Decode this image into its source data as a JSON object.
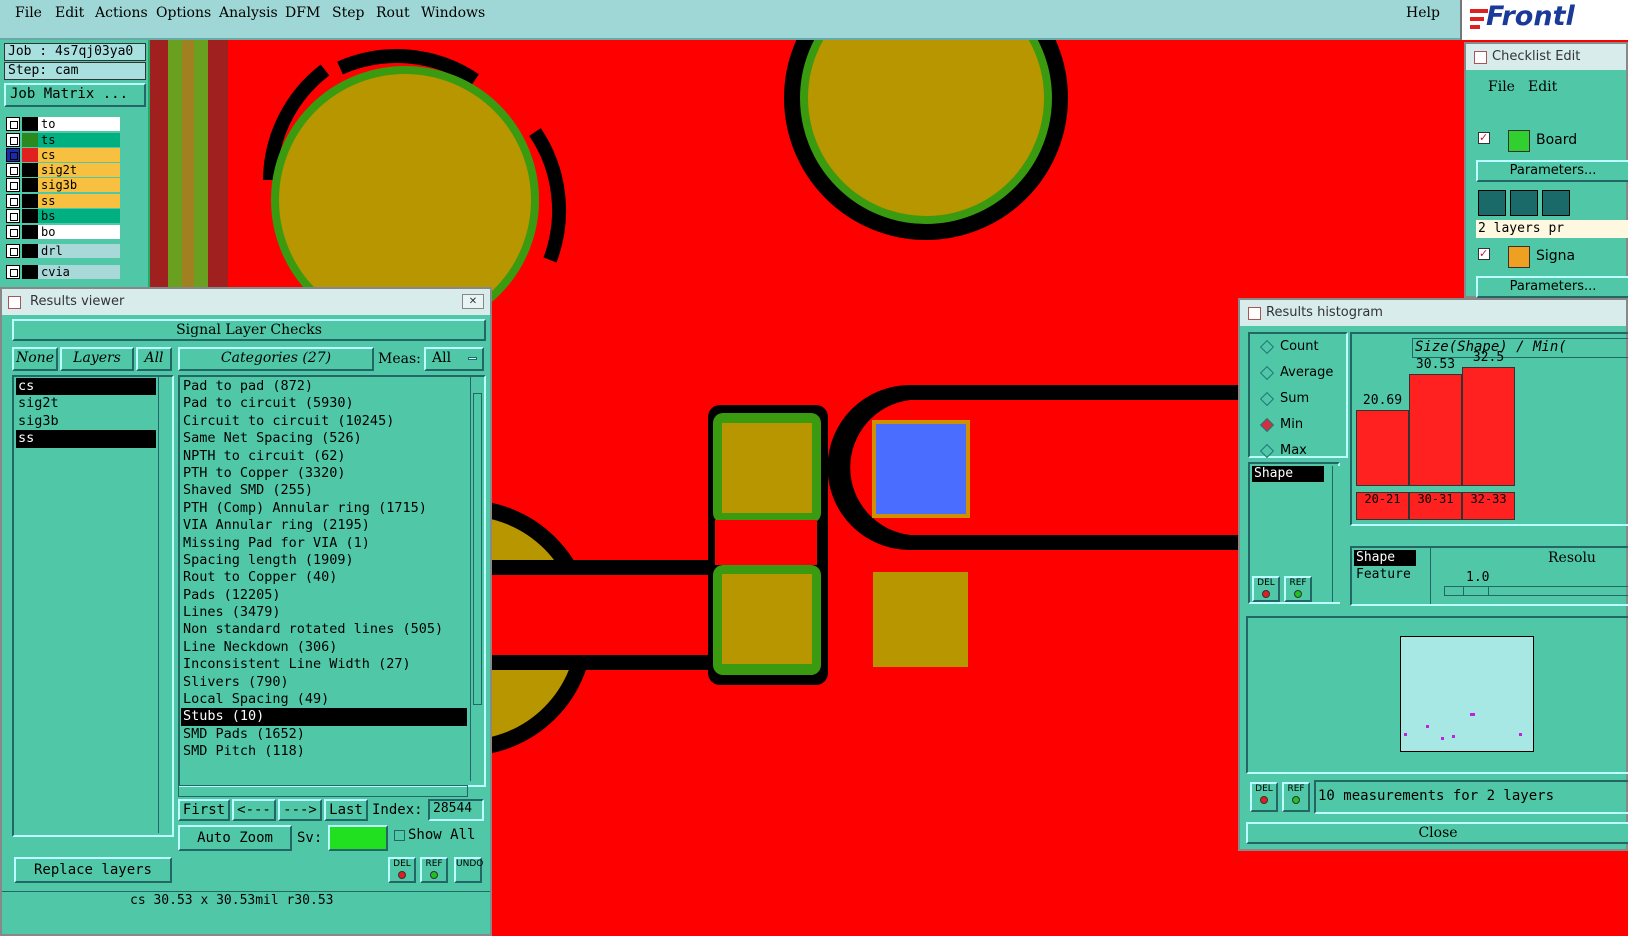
{
  "menubar": {
    "items": [
      "File",
      "Edit",
      "Actions",
      "Options",
      "Analysis",
      "DFM",
      "Step",
      "Rout",
      "Windows"
    ],
    "help": "Help",
    "brand": "Frontl"
  },
  "job": {
    "job_label": "Job : 4s7qj03ya0",
    "step_label": "Step: cam",
    "matrix_button": "Job Matrix ..."
  },
  "layers": [
    {
      "name": "to",
      "color": "#ffffff"
    },
    {
      "name": "ts",
      "color": "#00b080"
    },
    {
      "name": "cs",
      "color": "#f8c040"
    },
    {
      "name": "sig2t",
      "color": "#f8c040"
    },
    {
      "name": "sig3b",
      "color": "#f8c040"
    },
    {
      "name": "ss",
      "color": "#f8c040"
    },
    {
      "name": "bs",
      "color": "#00b080"
    },
    {
      "name": "bo",
      "color": "#ffffff"
    },
    {
      "name": "drl",
      "color": "#a8d8d8"
    },
    {
      "name": "cvia",
      "color": "#a8d8d8"
    }
  ],
  "results_viewer": {
    "title": "Results viewer",
    "header": "Signal Layer Checks",
    "btn_none": "None",
    "btn_layers": "Layers",
    "btn_all": "All",
    "categories_label": "Categories (27)",
    "meas_label": "Meas:",
    "meas_value": "All",
    "layer_list": [
      "cs",
      "sig2t",
      "sig3b",
      "ss"
    ],
    "category_list": [
      "Pad to pad (872)",
      "Pad to circuit (5930)",
      "Circuit to circuit (10245)",
      "Same Net Spacing (526)",
      "NPTH to circuit (62)",
      "PTH to Copper (3320)",
      "Shaved SMD (255)",
      "PTH (Comp) Annular ring (1715)",
      "VIA Annular ring (2195)",
      "Missing Pad for VIA (1)",
      "Spacing length (1909)",
      "Rout to Copper (40)",
      "Pads (12205)",
      "Lines (3479)",
      "Non standard rotated lines (505)",
      "Line Neckdown (306)",
      "Inconsistent Line Width (27)",
      "Slivers (790)",
      "Local Spacing (49)",
      "Stubs (10)",
      "SMD Pads (1652)",
      "SMD Pitch (118)"
    ],
    "selected_category": "Stubs (10)",
    "btn_first": "First",
    "btn_prev": "<---",
    "btn_next": "--->",
    "btn_last": "Last",
    "index_label": "Index:",
    "index_value": "28544",
    "auto_zoom": "Auto Zoom",
    "sv_label": "Sv:",
    "show_all": "Show All",
    "replace_layers": "Replace layers",
    "del": "DEL",
    "ref": "REF",
    "undo": "UNDO",
    "status": "cs 30.53 x 30.53mil  r30.53"
  },
  "checklist": {
    "title": "Checklist Edit",
    "menu_file": "File",
    "menu_edit": "Edit",
    "item1": "Board",
    "params1": "Parameters...",
    "layers_text": "2 layers pr",
    "item2": "Signa",
    "params2": "Parameters..."
  },
  "histogram": {
    "title": "Results histogram",
    "radios": [
      "Count",
      "Average",
      "Sum",
      "Min",
      "Max"
    ],
    "selected_radio": "Min",
    "shape_list": [
      "Shape"
    ],
    "header": "Size(Shape) / Min(",
    "shape_feature": [
      "Shape",
      "Feature"
    ],
    "resolution_label": "Resolu",
    "resolution_value": "1.0",
    "measurements": "10 measurements for 2 layers",
    "close": "Close",
    "del": "DEL",
    "ref": "REF"
  },
  "chart_data": {
    "type": "bar",
    "categories": [
      "20-21",
      "30-31",
      "32-33"
    ],
    "values": [
      20.69,
      30.53,
      32.5
    ],
    "value_labels": [
      "20.69",
      "30.53",
      "32.5"
    ],
    "title": "Size(Shape) / Min(",
    "ylim": [
      0,
      35
    ]
  }
}
